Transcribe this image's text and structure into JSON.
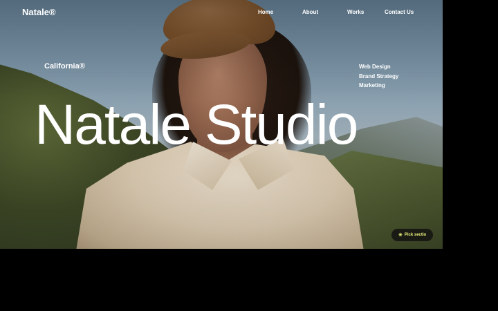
{
  "brand": {
    "name": "Natale®"
  },
  "nav": [
    {
      "label": "Home"
    },
    {
      "label": "About"
    },
    {
      "label": "Works"
    },
    {
      "label": "Contact Us"
    }
  ],
  "hero": {
    "location": "California®",
    "title": "Natale Studio",
    "services": [
      "Web Design",
      "Brand Strategy",
      "Marketing"
    ]
  },
  "pick_button": {
    "icon": "asterisk-icon",
    "glyph": "✳",
    "label": "Pick sectio"
  },
  "colors": {
    "accent": "#e9f27a",
    "pill_bg": "#1a1a14",
    "page_bg": "#000000"
  }
}
